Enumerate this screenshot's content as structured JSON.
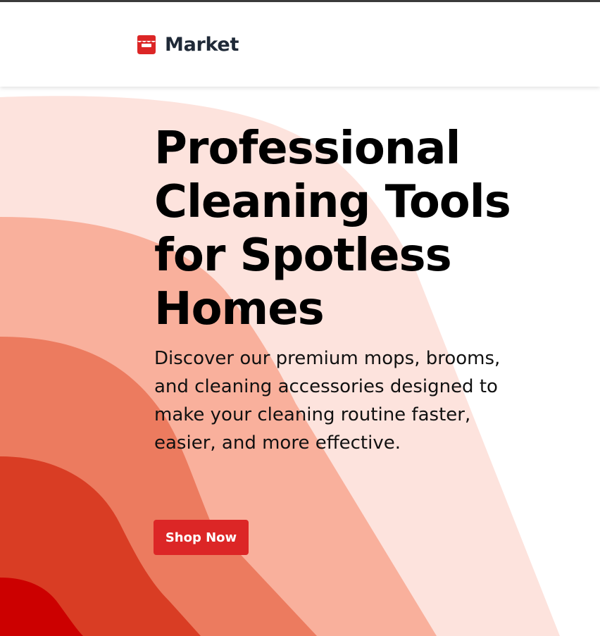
{
  "header": {
    "brand_name": "Market",
    "brand_icon": "storefront-icon",
    "brand_color": "#dc2626"
  },
  "hero": {
    "title": "Professional Cleaning Tools for Spotless Homes",
    "description": "Discover our premium mops, brooms, and cleaning accessories designed to make your cleaning routine faster, easier, and more effective.",
    "cta_label": "Shop Now"
  },
  "colors": {
    "accent": "#dc2626",
    "wave_lightest": "#fde3dd",
    "wave_light": "#f9b09c",
    "wave_mid": "#ec7b5f",
    "wave_dark": "#d93d24",
    "wave_darkest": "#cc0000"
  }
}
